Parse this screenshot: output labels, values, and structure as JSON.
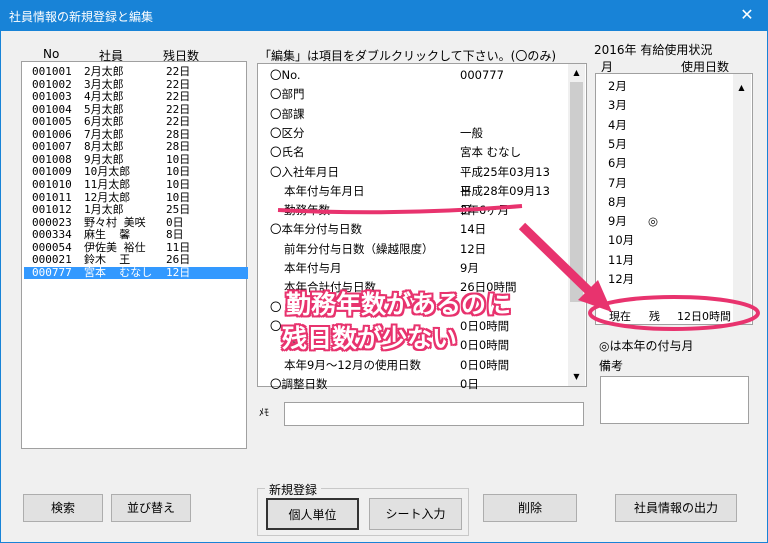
{
  "window": {
    "title": "社員情報の新規登録と編集",
    "close_glyph": "✕"
  },
  "employees": {
    "headers": {
      "no": "No",
      "name": "社員",
      "remaining": "残日数"
    },
    "rows": [
      {
        "no": "001001",
        "name": "2月太郎",
        "days": "22日"
      },
      {
        "no": "001002",
        "name": "3月太郎",
        "days": "22日"
      },
      {
        "no": "001003",
        "name": "4月太郎",
        "days": "22日"
      },
      {
        "no": "001004",
        "name": "5月太郎",
        "days": "22日"
      },
      {
        "no": "001005",
        "name": "6月太郎",
        "days": "22日"
      },
      {
        "no": "001006",
        "name": "7月太郎",
        "days": "28日"
      },
      {
        "no": "001007",
        "name": "8月太郎",
        "days": "28日"
      },
      {
        "no": "001008",
        "name": "9月太郎",
        "days": "10日"
      },
      {
        "no": "001009",
        "name": "10月太郎",
        "days": "10日"
      },
      {
        "no": "001010",
        "name": "11月太郎",
        "days": "10日"
      },
      {
        "no": "001011",
        "name": "12月太郎",
        "days": "10日"
      },
      {
        "no": "001012",
        "name": "1月太郎",
        "days": "25日"
      },
      {
        "no": "000023",
        "name": "野々村 美咲",
        "days": "0日"
      },
      {
        "no": "000334",
        "name": "麻生  馨",
        "days": "8日"
      },
      {
        "no": "000054",
        "name": "伊佐美 裕仕",
        "days": "11日"
      },
      {
        "no": "000021",
        "name": "鈴木  王",
        "days": "26日"
      },
      {
        "no": "000777",
        "name": "宮本  むなし",
        "days": "12日"
      }
    ],
    "selected_index": 16
  },
  "edit": {
    "instruction": "「編集」は項目をダブルクリックして下さい。(〇のみ)",
    "items": [
      {
        "label": "〇No.",
        "value": "000777"
      },
      {
        "label": "〇部門",
        "value": ""
      },
      {
        "label": "〇部課",
        "value": ""
      },
      {
        "label": "〇区分",
        "value": "一般"
      },
      {
        "label": "〇氏名",
        "value": "宮本 むなし"
      },
      {
        "label": "〇入社年月日",
        "value": "平成25年03月13日"
      },
      {
        "label": "本年付与年月日",
        "value": "平成28年09月13日"
      },
      {
        "label": "勤務年数",
        "value": "3年6ヶ月"
      },
      {
        "label": "〇本年分付与日数",
        "value": "14日"
      },
      {
        "label": "前年分付与日数（繰越限度）",
        "value": "12日"
      },
      {
        "label": "本年付与月",
        "value": "9月"
      },
      {
        "label": "本年合計付与日数",
        "value": "26日0時間"
      },
      {
        "label": "〇",
        "value": ""
      },
      {
        "label": "〇",
        "value": "0日0時間"
      },
      {
        "label": "本",
        "value": "0日0時間"
      },
      {
        "label": "本年9月～12月の使用日数",
        "value": "0日0時間"
      },
      {
        "label": "〇調整日数",
        "value": "0日"
      }
    ]
  },
  "memo": {
    "label": "ﾒﾓ",
    "value": ""
  },
  "usage": {
    "title": "2016年 有給使用状況",
    "col_month": "月",
    "col_days": "使用日数",
    "months": [
      {
        "month": "2月",
        "mark": ""
      },
      {
        "month": "3月",
        "mark": ""
      },
      {
        "month": "4月",
        "mark": ""
      },
      {
        "month": "5月",
        "mark": ""
      },
      {
        "month": "6月",
        "mark": ""
      },
      {
        "month": "7月",
        "mark": ""
      },
      {
        "month": "8月",
        "mark": ""
      },
      {
        "month": "9月",
        "mark": "◎"
      },
      {
        "month": "10月",
        "mark": ""
      },
      {
        "month": "11月",
        "mark": ""
      },
      {
        "month": "12月",
        "mark": ""
      }
    ],
    "current_label": "現在",
    "remaining_label": "残",
    "current_value": "12日0時間",
    "legend": "◎は本年の付与月",
    "notes_label": "備考"
  },
  "buttons": {
    "search": "検索",
    "sort": "並び替え",
    "new_group": "新規登録",
    "individual": "個人単位",
    "sheet_input": "シート入力",
    "delete": "削除",
    "export": "社員情報の出力"
  },
  "annotation": {
    "line1": "勤務年数があるのに",
    "line2": "残日数が少ない",
    "color": "#e8336e"
  }
}
